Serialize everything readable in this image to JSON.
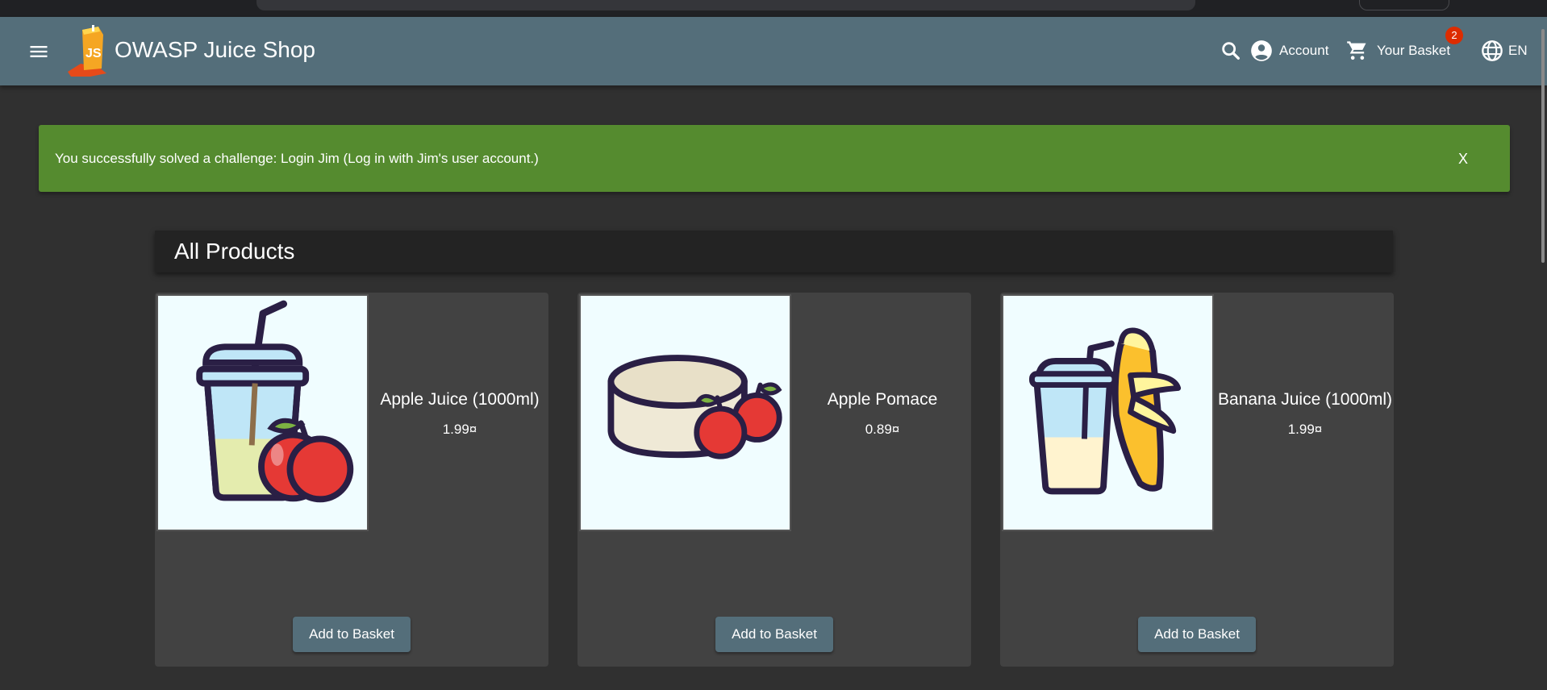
{
  "header": {
    "menu_icon": "menu-icon",
    "app_title": "OWASP Juice Shop",
    "account_label": "Account",
    "basket_label": "Your Basket",
    "basket_count": "2",
    "language_label": "EN"
  },
  "snackbar": {
    "message": "You successfully solved a challenge: Login Jim (Log in with Jim's user account.)",
    "close_label": "X",
    "color": "#558b2f"
  },
  "main": {
    "title": "All Products",
    "products": [
      {
        "name": "Apple Juice (1000ml)",
        "price": "1.99¤",
        "button": "Add to Basket",
        "image_icon": "apple-juice-image"
      },
      {
        "name": "Apple Pomace",
        "price": "0.89¤",
        "button": "Add to Basket",
        "image_icon": "apple-pomace-image"
      },
      {
        "name": "Banana Juice (1000ml)",
        "price": "1.99¤",
        "button": "Add to Basket",
        "image_icon": "banana-juice-image"
      }
    ]
  },
  "colors": {
    "toolbar": "#546e7a",
    "background": "#303030",
    "card": "#424242",
    "badge": "#dd2c00"
  }
}
